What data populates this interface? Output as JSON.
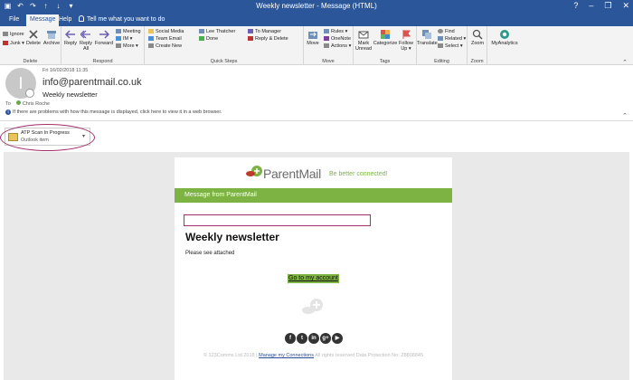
{
  "window": {
    "title": "Weekly newsletter  -  Message (HTML)",
    "controls": [
      "?",
      "–",
      "❐",
      "✕"
    ]
  },
  "tabs": {
    "items": [
      "File",
      "Message",
      "Help"
    ],
    "active": "Message",
    "tell_me": "Tell me what you want to do"
  },
  "ribbon": {
    "delete": {
      "label": "Delete",
      "ignore": "Ignore",
      "junk": "Junk ▾",
      "delete": "Delete",
      "archive": "Archive"
    },
    "respond": {
      "label": "Respond",
      "reply": "Reply",
      "reply_all_1": "Reply",
      "reply_all_2": "All",
      "forward": "Forward",
      "meeting": "Meeting",
      "im": "IM ▾",
      "more": "More ▾"
    },
    "quick_steps": {
      "label": "Quick Steps",
      "items": [
        "Social Media",
        "Lee Thatcher",
        "To Manager",
        "Team Email",
        "Done",
        "Reply & Delete",
        "Create New"
      ]
    },
    "move": {
      "label": "Move",
      "move": "Move",
      "rules": "Rules ▾",
      "onenote": "OneNote",
      "actions": "Actions ▾"
    },
    "tags": {
      "label": "Tags",
      "mark_unread_1": "Mark",
      "mark_unread_2": "Unread",
      "categorize": "Categorize",
      "follow_up_1": "Follow",
      "follow_up_2": "Up ▾"
    },
    "editing": {
      "label": "Editing",
      "translate": "Translate",
      "find": "Find",
      "related": "Related ▾",
      "select": "Select ▾"
    },
    "zoom": {
      "label": "Zoom",
      "zoom": "Zoom"
    },
    "addin": {
      "myanalytics": "MyAnalytics"
    }
  },
  "header": {
    "avatar_initial": "I",
    "date": "Fri 16/02/2018 11:35",
    "from": "info@parentmail.co.uk",
    "subject": "Weekly newsletter",
    "to_label": "To",
    "to_name": "Chris Roche",
    "info_text": "If there are problems with how this message is displayed, click here to view it in a web browser."
  },
  "attachment": {
    "name": "ATP Scan In Progress",
    "type": "Outlook item"
  },
  "email": {
    "logo_text": "ParentMail",
    "tagline": "Be better connected!",
    "banner": "Message from ParentMail",
    "heading": "Weekly newsletter",
    "body": "Please see attached",
    "cta": "Go to my account",
    "socials": [
      "f",
      "t",
      "in",
      "g+",
      "▶"
    ],
    "footer_pre": "© 123Comms Ltd 2018 |",
    "footer_link": "Manage my Connections",
    "footer_post": "All rights reserved Data Protection No: Z8808845"
  },
  "colors": {
    "brand_blue": "#2b579a",
    "parentmail_green": "#7cb342",
    "annotation_magenta": "#a0306e"
  }
}
